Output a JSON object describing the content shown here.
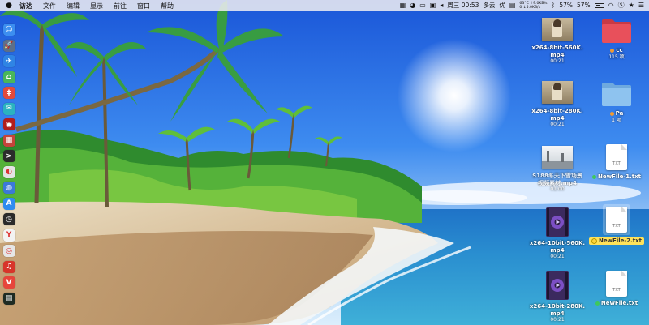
{
  "menubar": {
    "apple_icon": "apple-icon",
    "items": [
      "访达",
      "文件",
      "编辑",
      "显示",
      "前往",
      "窗口",
      "帮助"
    ],
    "status": {
      "datetime": "周三 00:53",
      "weather": "多云",
      "you": "优",
      "cpu_temp": "63°C",
      "net_up": "9.0KB/s",
      "net_zero": "0",
      "net_down": "5.0KB/s",
      "cpu_pct": "57%",
      "battery_pct": "57%",
      "battery_level": 0.57,
      "icons": [
        "wechat-icon",
        "display-icon",
        "media-icon",
        "audio-icon",
        "input-icon",
        "screen-icon",
        "bluetooth-icon",
        "wifi-icon",
        "s-icon",
        "star-icon",
        "menu-icon"
      ]
    }
  },
  "dock": {
    "icons": [
      {
        "name": "finder-icon",
        "color": "#3c8ef0",
        "glyph": "☺"
      },
      {
        "name": "launchpad-icon",
        "color": "#5d6f88",
        "glyph": "🚀"
      },
      {
        "name": "safari-icon",
        "color": "#2f84e4",
        "glyph": "✈"
      },
      {
        "name": "maps-icon",
        "color": "#49b75a",
        "glyph": "⌂"
      },
      {
        "name": "red-app-icon",
        "color": "#e24a3b",
        "glyph": "‡"
      },
      {
        "name": "messages-icon",
        "color": "#2bb3c0",
        "glyph": "✉"
      },
      {
        "name": "notes-icon",
        "color": "#b21d1d",
        "glyph": "◉"
      },
      {
        "name": "photos-icon",
        "color": "#c5443b",
        "glyph": "▦"
      },
      {
        "name": "terminal-icon",
        "color": "#2b2b2b",
        "glyph": ">"
      },
      {
        "name": "preview-icon",
        "color": "#e3e3e3",
        "glyph": "◐"
      },
      {
        "name": "globe-icon",
        "color": "#3b79d8",
        "glyph": "◍"
      },
      {
        "name": "appstore-icon",
        "color": "#2f8bf0",
        "glyph": "A"
      },
      {
        "name": "clock-icon",
        "color": "#2a2a2a",
        "glyph": "◷"
      },
      {
        "name": "yandex-icon",
        "color": "#f3f3f3",
        "glyph": "Y"
      },
      {
        "name": "chrome-icon",
        "color": "#e6e6e6",
        "glyph": "◎"
      },
      {
        "name": "netease-icon",
        "color": "#d8352a",
        "glyph": "♫"
      },
      {
        "name": "vivaldi-icon",
        "color": "#e7453b",
        "glyph": "V"
      },
      {
        "name": "console-icon",
        "color": "#1e2b23",
        "glyph": "▤"
      }
    ]
  },
  "desktop": {
    "files": [
      {
        "name": "x264-8bit-560K.\nmp4",
        "meta": "00:21"
      },
      {
        "name": "x264-8bit-280K.\nmp4",
        "meta": "00:21"
      },
      {
        "name": "S188冬天下雪场景\n视频素材.mp4",
        "meta": "01:00"
      },
      {
        "name": "x264-10bit-560K.\nmp4",
        "meta": "00:21"
      },
      {
        "name": "x264-10bit-280K.\nmp4",
        "meta": "00:21"
      }
    ],
    "folders": [
      {
        "name": "cc",
        "meta": "115 项",
        "tag_color": "#f39a2e",
        "folder_color": "#e8505b"
      },
      {
        "name": "Pa",
        "meta": "1 项",
        "tag_color": "#f39a2e",
        "folder_color": "#8ec3ef"
      }
    ],
    "docs": [
      {
        "name": "NewFile-1.txt",
        "ext": "TXT",
        "tag_color": "#3ec85c"
      },
      {
        "name": "NewFile-2.txt",
        "ext": "TXT",
        "tag_color": "#ffd43b"
      },
      {
        "name": "NewFile.txt",
        "ext": "TXT",
        "tag_color": "#3ec85c"
      }
    ]
  }
}
